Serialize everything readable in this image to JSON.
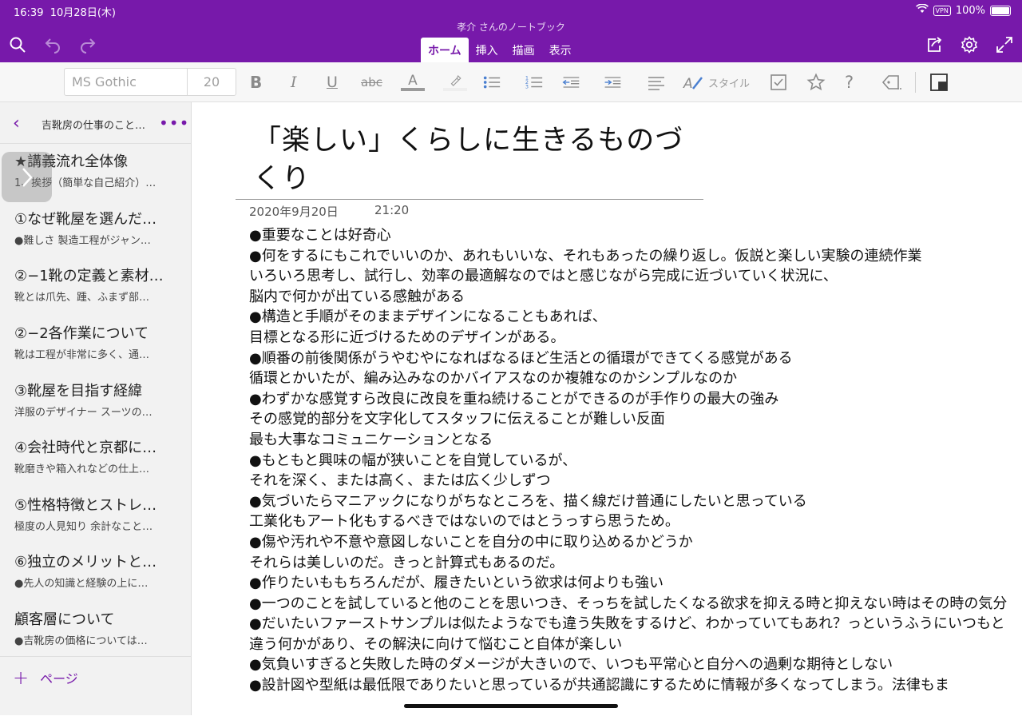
{
  "status": {
    "time": "16:39",
    "date": "10月28日(木)",
    "vpn": "VPN",
    "battery": "100%"
  },
  "app": {
    "notebook_title": "孝介 さんのノートブック"
  },
  "tabs": [
    {
      "label": "ホーム",
      "active": true
    },
    {
      "label": "挿入"
    },
    {
      "label": "描画"
    },
    {
      "label": "表示"
    }
  ],
  "ribbon": {
    "font_name": "MS Gothic",
    "font_size": "20",
    "style_label": "スタイル"
  },
  "sidebar": {
    "section_name": "吉靴房の仕事のこと…",
    "add_page_label": "ページ",
    "pages": [
      {
        "title": "★講義流れ全体像",
        "snippet": "1、挨拶（簡単な自己紹介）…"
      },
      {
        "title": "①なぜ靴屋を選んだ…",
        "snippet": "●難しさ 製造工程がジャン…"
      },
      {
        "title": "②−1靴の定義と素材…",
        "snippet": "靴とは爪先、踵、ふまず部…"
      },
      {
        "title": "②−2各作業について",
        "snippet": "靴は工程が非常に多く、通…"
      },
      {
        "title": "③靴屋を目指す経緯",
        "snippet": "洋服のデザイナー スーツの…"
      },
      {
        "title": "④会社時代と京都に…",
        "snippet": "靴磨きや箱入れなどの仕上…"
      },
      {
        "title": "⑤性格特徴とストレ…",
        "snippet": "極度の人見知り 余計なこと…"
      },
      {
        "title": "⑥独立のメリットと…",
        "snippet": "●先人の知識と経験の上に…"
      },
      {
        "title": "顧客層について",
        "snippet": "●吉靴房の価格については…"
      }
    ]
  },
  "note": {
    "title": "「楽しい」くらしに生きるものづくり",
    "date": "2020年9月20日",
    "time": "21:20",
    "lines": [
      "●重要なことは好奇心",
      "●何をするにもこれでいいのか、あれもいいな、それもあったの繰り返し。仮説と楽しい実験の連続作業",
      "いろいろ思考し、試行し、効率の最適解なのではと感じながら完成に近づいていく状況に、",
      "脳内で何かが出ている感触がある",
      "●構造と手順がそのままデザインになることもあれば、",
      "目標となる形に近づけるためのデザインがある。",
      "●順番の前後関係がうやむやになればなるほど生活との循環ができてくる感覚がある",
      "循環とかいたが、編み込みなのかバイアスなのか複雑なのかシンプルなのか",
      "●わずかな感覚すら改良に改良を重ね続けることができるのが手作りの最大の強み",
      "その感覚的部分を文字化してスタッフに伝えることが難しい反面",
      "最も大事なコミュニケーションとなる",
      "●もともと興味の幅が狭いことを自覚しているが、",
      "それを深く、または高く、または広く少しずつ",
      "●気づいたらマニアックになりがちなところを、描く線だけ普通にしたいと思っている",
      "工業化もアート化もするべきではないのではとうっすら思うため。",
      "●傷や汚れや不意や意図しないことを自分の中に取り込めるかどうか",
      "それらは美しいのだ。きっと計算式もあるのだ。",
      "●作りたいももちろんだが、履きたいという欲求は何よりも強い",
      "●一つのことを試していると他のことを思いつき、そっちを試したくなる欲求を抑える時と抑えない時はその時の気分",
      "●だいたいファーストサンプルは似たようなでも違う失敗をするけど、わかっていてもあれ？っというふうにいつもと違う何かがあり、その解決に向けて悩むこと自体が楽しい",
      "●気負いすぎると失敗した時のダメージが大きいので、いつも平常心と自分への過剰な期待としない",
      "●設計図や型紙は最低限でありたいと思っているが共通認識にするために情報が多くなってしまう。法律もま"
    ]
  }
}
